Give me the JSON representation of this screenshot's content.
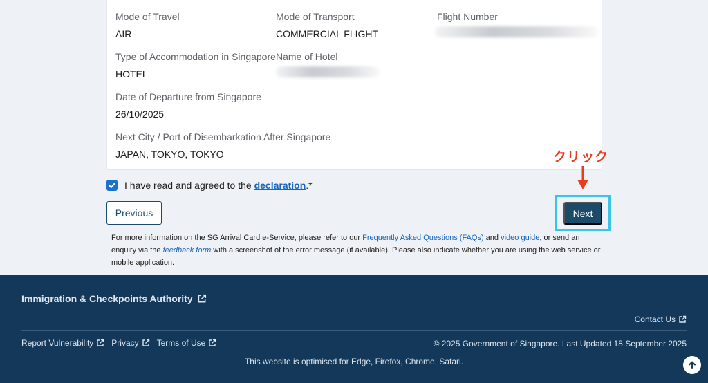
{
  "trip": {
    "mode_of_travel": {
      "label": "Mode of Travel",
      "value": "AIR"
    },
    "mode_of_transport": {
      "label": "Mode of Transport",
      "value": "COMMERCIAL FLIGHT"
    },
    "flight_number": {
      "label": "Flight Number"
    },
    "accommodation_type": {
      "label": "Type of Accommodation in Singapore",
      "value": "HOTEL"
    },
    "hotel_name": {
      "label": "Name of Hotel"
    },
    "departure_date": {
      "label": "Date of Departure from Singapore",
      "value": "26/10/2025"
    },
    "next_city": {
      "label": "Next City / Port of Disembarkation After Singapore",
      "value": "JAPAN, TOKYO, TOKYO"
    }
  },
  "declaration": {
    "checked": true,
    "text_before": "I have read and agreed to the ",
    "link_text": "declaration",
    "text_after": ".*"
  },
  "buttons": {
    "previous": "Previous",
    "next": "Next"
  },
  "annotation": {
    "click_note": "クリック"
  },
  "info": {
    "t1": "For more information on the SG Arrival Card e-Service, please refer to our ",
    "faq_link": "Frequently Asked Questions (FAQs)",
    "t2": " and ",
    "video_link": "video guide",
    "t3": ", or send an enquiry via the ",
    "feedback_link": "feedback form",
    "t4": " with a screenshot of the error message (if available). Please also indicate whether you are using the web service or mobile application."
  },
  "footer": {
    "authority": "Immigration & Checkpoints Authority",
    "contact": "Contact Us",
    "links": [
      "Report Vulnerability",
      "Privacy",
      "Terms of Use"
    ],
    "copyright": "© 2025 Government of Singapore.  Last Updated 18 September 2025",
    "optimised": "This website is optimised for Edge, Firefox, Chrome, Safari."
  },
  "colors": {
    "primary": "#1b4a6b",
    "footer_bg": "#13385a",
    "link": "#1565c0",
    "highlight": "#3cc4e6",
    "annotation": "#ea3a1f"
  }
}
